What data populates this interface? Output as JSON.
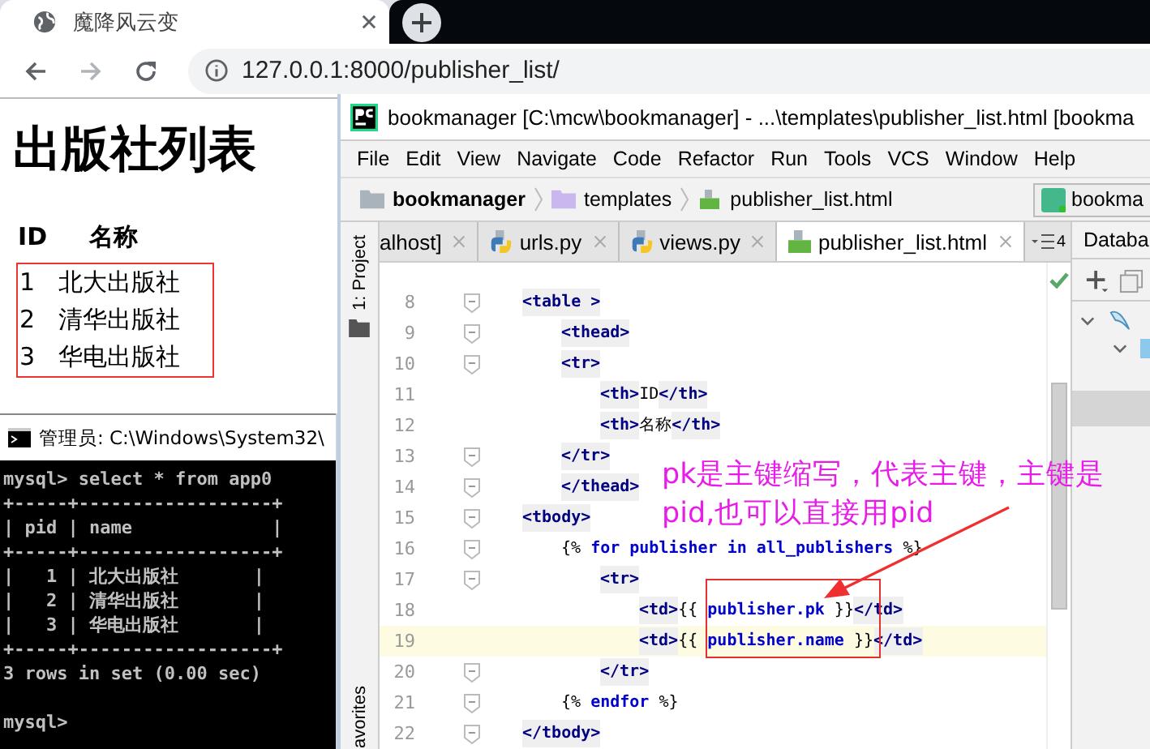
{
  "browser": {
    "tab_title": "魔降风云变",
    "url": "127.0.0.1:8000/publisher_list/",
    "page": {
      "heading": "出版社列表",
      "columns": [
        "ID",
        "名称"
      ],
      "rows": [
        [
          "1",
          "北大出版社"
        ],
        [
          "2",
          "清华出版社"
        ],
        [
          "3",
          "华电出版社"
        ]
      ]
    }
  },
  "terminal": {
    "title": "管理员: C:\\Windows\\System32\\",
    "lines": [
      "mysql> select * from app0",
      "+-----+------------------+",
      "| pid | name             |",
      "+-----+------------------+",
      "|   1 | 北大出版社       |",
      "|   2 | 清华出版社       |",
      "|   3 | 华电出版社       |",
      "+-----+------------------+",
      "3 rows in set (0.00 sec)"
    ],
    "prompt": "mysql>"
  },
  "ide": {
    "title": "bookmanager [C:\\mcw\\bookmanager] - ...\\templates\\publisher_list.html [bookma",
    "menu": [
      "File",
      "Edit",
      "View",
      "Navigate",
      "Code",
      "Refactor",
      "Run",
      "Tools",
      "VCS",
      "Window",
      "Help"
    ],
    "breadcrumb": [
      "bookmanager",
      "templates",
      "publisher_list.html"
    ],
    "run_config": "bookma",
    "tabs": [
      {
        "label": "alhost]",
        "selected": false,
        "kind": "plain"
      },
      {
        "label": "urls.py",
        "selected": false,
        "kind": "python"
      },
      {
        "label": "views.py",
        "selected": false,
        "kind": "python"
      },
      {
        "label": "publisher_list.html",
        "selected": true,
        "kind": "html"
      }
    ],
    "tab_overflow": "4",
    "side_tools": [
      "1: Project",
      "avorites"
    ],
    "side_panel_title": "Databa",
    "lines": [
      {
        "number": "8",
        "fold": true,
        "current": false,
        "segments": [
          {
            "kind": "tag",
            "text": "<table >"
          }
        ],
        "children": [
          {
            "number": "9",
            "fold": true,
            "current": false,
            "segments": [
              {
                "kind": "tag",
                "text": "<thead>"
              }
            ]
          },
          {
            "number": "10",
            "fold": true,
            "current": false,
            "segments": [
              {
                "kind": "tag",
                "text": "<tr>"
              }
            ],
            "children": [
              {
                "number": "11",
                "fold": false,
                "current": false,
                "segments": [
                  {
                    "kind": "tag",
                    "text": "<th>"
                  },
                  {
                    "kind": "text",
                    "text": "ID"
                  },
                  {
                    "kind": "tag",
                    "text": "</th>"
                  }
                ]
              },
              {
                "number": "12",
                "fold": false,
                "current": false,
                "segments": [
                  {
                    "kind": "tag",
                    "text": "<th>"
                  },
                  {
                    "kind": "text",
                    "text": "名称"
                  },
                  {
                    "kind": "tag",
                    "text": "</th>"
                  }
                ]
              }
            ]
          },
          {
            "number": "13",
            "fold": true,
            "current": false,
            "segments": [
              {
                "kind": "tag",
                "text": "</tr>"
              }
            ]
          },
          {
            "number": "14",
            "fold": true,
            "current": false,
            "segments": [
              {
                "kind": "tag",
                "text": "</thead>"
              }
            ]
          }
        ]
      },
      {
        "number": "15",
        "fold": true,
        "current": false,
        "segments": [
          {
            "kind": "tag",
            "text": "<tbody>"
          }
        ],
        "children": [
          {
            "number": "16",
            "fold": true,
            "current": false,
            "segments": [
              {
                "kind": "text",
                "text": "{% "
              },
              {
                "kind": "var",
                "text": "for publisher in all_publishers"
              },
              {
                "kind": "text",
                "text": " %}"
              }
            ],
            "children": [
              {
                "number": "17",
                "fold": true,
                "current": false,
                "segments": [
                  {
                    "kind": "tag",
                    "text": "<tr>"
                  }
                ],
                "children": [
                  {
                    "number": "18",
                    "fold": false,
                    "current": false,
                    "segments": [
                      {
                        "kind": "tag",
                        "text": "<td>"
                      },
                      {
                        "kind": "text",
                        "text": "{{ "
                      },
                      {
                        "kind": "var",
                        "text": "publisher.pk"
                      },
                      {
                        "kind": "text",
                        "text": " }}"
                      },
                      {
                        "kind": "tag",
                        "text": "</td>"
                      }
                    ]
                  },
                  {
                    "number": "19",
                    "fold": false,
                    "current": true,
                    "segments": [
                      {
                        "kind": "tag",
                        "text": "<td>"
                      },
                      {
                        "kind": "text",
                        "text": "{{ "
                      },
                      {
                        "kind": "var",
                        "text": "publisher.name"
                      },
                      {
                        "kind": "text",
                        "text": " }}"
                      },
                      {
                        "kind": "tag",
                        "text": "</td>"
                      }
                    ]
                  }
                ]
              },
              {
                "number": "20",
                "fold": true,
                "current": false,
                "segments": [
                  {
                    "kind": "tag",
                    "text": "</tr>"
                  }
                ]
              }
            ]
          },
          {
            "number": "21",
            "fold": true,
            "current": false,
            "segments": [
              {
                "kind": "text",
                "text": "{% "
              },
              {
                "kind": "var",
                "text": "endfor"
              },
              {
                "kind": "text",
                "text": " %}"
              }
            ]
          }
        ]
      },
      {
        "number": "22",
        "fold": true,
        "current": false,
        "segments": [
          {
            "kind": "tag",
            "text": "</tbody>"
          }
        ]
      }
    ]
  },
  "annotation": {
    "text": "pk是主键缩写，代表主键，主键是\npid,也可以直接用pid"
  }
}
